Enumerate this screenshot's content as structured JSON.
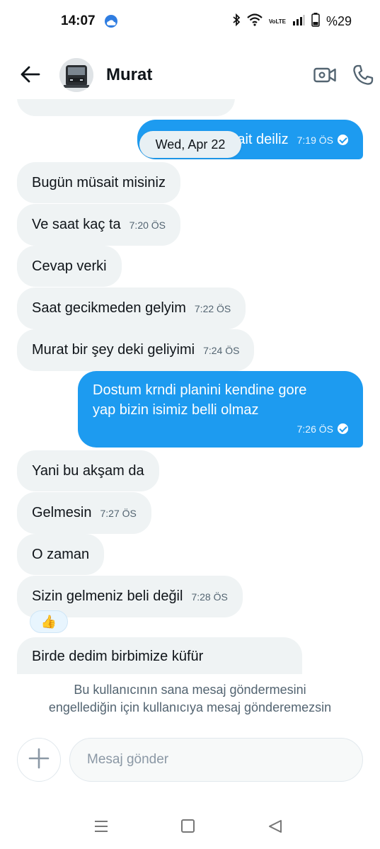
{
  "status_bar": {
    "time": "14:07",
    "battery": "%29",
    "network": "VoLTE"
  },
  "header": {
    "title": "Murat",
    "icons": [
      "back-arrow-icon",
      "video-camera-icon",
      "phone-icon"
    ]
  },
  "date_divider": "Wed, Apr 22",
  "messages": [
    {
      "dir": "out",
      "text": "Yarın müsait deiliz",
      "time": "7:19 ÖS",
      "read": true
    },
    {
      "dir": "in",
      "text": "Bugün müsait misiniz",
      "time": ""
    },
    {
      "dir": "in",
      "text": "Ve saat kaç ta",
      "time": "7:20 ÖS"
    },
    {
      "dir": "in",
      "text": "Cevap verki",
      "time": ""
    },
    {
      "dir": "in",
      "text": "Saat gecikmeden gelyim",
      "time": "7:22 ÖS"
    },
    {
      "dir": "in",
      "text": "Murat bir şey deki geliyimi",
      "time": "7:24 ÖS"
    },
    {
      "dir": "out",
      "line1": "Dostum krndi planini kendine  gore",
      "line2": "yap bizin isimiz belli olmaz",
      "time": "7:26 ÖS",
      "read": true
    },
    {
      "dir": "in",
      "text": "Yani bu akşam da",
      "time": ""
    },
    {
      "dir": "in",
      "text": "Gelmesin",
      "time": "7:27 ÖS"
    },
    {
      "dir": "in",
      "text": "O zaman",
      "time": ""
    },
    {
      "dir": "in",
      "text": "Sizin gelmeniz beli değil",
      "time": "7:28 ÖS",
      "reaction": "👍"
    },
    {
      "dir": "in",
      "text": "Birde dedim birbimize küfür",
      "time": ""
    }
  ],
  "blocked_notice": {
    "line1": "Bu kullanıcının sana mesaj göndermesini",
    "line2": "engellediğin için kullanıcıya mesaj gönderemezsin"
  },
  "composer": {
    "placeholder": "Mesaj gönder"
  },
  "colors": {
    "accent": "#1d9bf0",
    "incoming_bubble": "#eff3f4",
    "muted_text": "#536471"
  }
}
